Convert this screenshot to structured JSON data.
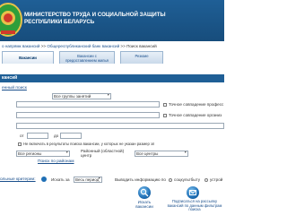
{
  "header": {
    "title_line1": "МИНИСТЕРСТВО ТРУДА И СОЦИАЛЬНОЙ ЗАЩИТЫ",
    "title_line2": "РЕСПУБЛИКИ БЕЛАРУСЬ",
    "colors": {
      "header_bg": "#1f5f96",
      "link": "#1a4f8c"
    }
  },
  "breadcrumb": {
    "item1": "о напрямк вакансий",
    "sep1": " >> ",
    "item2": "Общереспубликанский банк вакансий",
    "sep2": " >> ",
    "item3": "Поиск вакансий"
  },
  "tabs": [
    {
      "label_line1": "Вакансии",
      "label_line2": ""
    },
    {
      "label_line1": "Вакансии с",
      "label_line2": "предоставлением жилья"
    },
    {
      "label_line1": "Резюме",
      "label_line2": ""
    }
  ],
  "section": {
    "title": "кансий"
  },
  "form": {
    "extended_search_link": "енный поиск",
    "group_select_value": "Все группы занятий",
    "exact_match_prof": "Точное совпадение професс",
    "exact_match_org": "Точное совпадение организ",
    "salary_from_label": "от",
    "salary_to_label": "до",
    "exclude_label": "Не включать в результаты поиска вакансии, у которых не указан размер зп",
    "region_label": "Все регионы",
    "district_label_line1": "Районный (областной)",
    "district_label_line2": "центр",
    "district_value": "Все центры",
    "districts_link": "Поиск по районам"
  },
  "bottom": {
    "conditions_label": "ольные критерии:",
    "period_label": "Искать за",
    "period_value": "Весь период",
    "output_label": "Выводить информацию по",
    "social_label": "соцкультбыту",
    "search_label": "Искать",
    "search_label2": "вакансии",
    "subscribe_line1": "Подписаться на рассылку",
    "subscribe_line2": "вакансий по данным фильтрам",
    "subscribe_line3": "поиска"
  }
}
